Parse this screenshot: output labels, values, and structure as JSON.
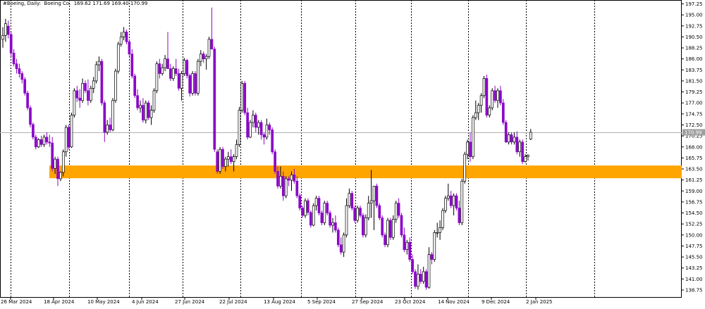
{
  "header": {
    "symbol_period": "#Boeing, Daily:",
    "description": "Boeing Co.",
    "ohlc": "169.62 171.69 169.40 170.99"
  },
  "colors": {
    "bull_candle": "#ffffff",
    "bull_outline": "#000000",
    "bear_candle": "#8b08c8",
    "zone": "#ffa500",
    "current_price_line": "#b0b0b0",
    "price_tag": "#9e9e9e",
    "grid_vertical": "#000000"
  },
  "chart_data": {
    "type": "candlestick",
    "y_axis_ticks": [
      "197.25",
      "195.00",
      "192.75",
      "190.50",
      "188.25",
      "186.00",
      "183.75",
      "181.50",
      "179.25",
      "177.00",
      "174.75",
      "172.50",
      "170.25",
      "168.00",
      "165.75",
      "163.50",
      "161.25",
      "159.00",
      "156.75",
      "154.50",
      "152.25",
      "150.00",
      "147.75",
      "145.50",
      "143.25",
      "141.00",
      "138.75"
    ],
    "x_axis_labels": [
      "26 Mar 2024",
      "18 Apr 2024",
      "10 May 2024",
      "4 Jun 2024",
      "27 Jun 2024",
      "22 Jul 2024",
      "13 Aug 2024",
      "5 Sep 2024",
      "27 Sep 2024",
      "23 Oct 2024",
      "14 Nov 2024",
      "9 Dec 2024",
      "2 Jan 2025"
    ],
    "ylim": [
      137.5,
      198.0
    ],
    "current_price": 170.99,
    "current_price_label": "170.99",
    "zone": {
      "from": 161.6,
      "to": 164.2
    },
    "candles": [
      [
        190,
        192.5,
        188.3,
        190.8
      ],
      [
        190.8,
        194.2,
        189.5,
        193.2
      ],
      [
        192.7,
        193.8,
        190.2,
        191
      ],
      [
        191,
        191.5,
        186.5,
        187.2
      ],
      [
        187.2,
        188,
        184.5,
        185
      ],
      [
        185,
        186,
        183,
        184
      ],
      [
        184,
        185,
        182.2,
        183
      ],
      [
        183,
        183.5,
        181,
        181.8
      ],
      [
        181.8,
        182.3,
        178.5,
        179
      ],
      [
        179,
        179.5,
        175.5,
        176
      ],
      [
        176,
        176.5,
        172,
        172.6
      ],
      [
        172.6,
        173,
        169.5,
        170
      ],
      [
        170,
        170.5,
        167.5,
        168
      ],
      [
        168,
        169.8,
        167.8,
        169.5
      ],
      [
        169.5,
        170.3,
        168,
        168.5
      ],
      [
        168.5,
        170.5,
        168,
        170
      ],
      [
        170,
        171,
        168.5,
        169
      ],
      [
        169,
        170.5,
        168,
        168.8
      ],
      [
        168.8,
        170,
        163,
        163.6
      ],
      [
        163.6,
        166,
        162.5,
        165.5
      ],
      [
        165.5,
        166,
        160,
        161.5
      ],
      [
        161.5,
        163,
        161,
        162.8
      ],
      [
        162.8,
        167.5,
        162,
        167
      ],
      [
        167,
        172.5,
        166,
        172
      ],
      [
        172,
        172.5,
        167.5,
        168
      ],
      [
        168,
        175,
        167.8,
        174.5
      ],
      [
        174.5,
        180,
        174,
        179.5
      ],
      [
        179.5,
        180.5,
        177.2,
        178
      ],
      [
        178,
        179.8,
        176,
        177.5
      ],
      [
        177.5,
        182,
        177,
        181
      ],
      [
        181,
        181.6,
        179,
        179.5
      ],
      [
        179.5,
        181.8,
        176.5,
        177.5
      ],
      [
        177.5,
        180.5,
        177,
        180
      ],
      [
        180,
        182.3,
        179,
        181.5
      ],
      [
        181.5,
        185.5,
        181,
        184.8
      ],
      [
        184.8,
        186.5,
        183.5,
        185.5
      ],
      [
        185.5,
        186,
        176.5,
        177
      ],
      [
        177,
        177.5,
        169,
        171
      ],
      [
        171,
        173.5,
        170.5,
        172.5
      ],
      [
        172.5,
        174,
        171,
        171.5
      ],
      [
        171.5,
        178,
        171.2,
        177.5
      ],
      [
        177.5,
        184,
        177,
        183.5
      ],
      [
        183.5,
        189.5,
        183,
        189
      ],
      [
        189,
        191.5,
        188.5,
        190.5
      ],
      [
        190.5,
        192.5,
        189.8,
        191.5
      ],
      [
        191.5,
        192,
        189,
        189.5
      ],
      [
        189.5,
        190,
        186.5,
        187
      ],
      [
        187,
        188,
        182,
        182.5
      ],
      [
        182.5,
        183,
        178,
        178.5
      ],
      [
        178.5,
        179.8,
        175.5,
        176
      ],
      [
        176,
        177.5,
        175,
        176.5
      ],
      [
        176.5,
        178,
        173,
        173.5
      ],
      [
        173.5,
        177.5,
        172.8,
        177
      ],
      [
        177,
        177.5,
        173.5,
        174
      ],
      [
        174,
        176.5,
        172.5,
        175.5
      ],
      [
        175.5,
        180,
        175,
        179.5
      ],
      [
        179.5,
        185.5,
        179,
        185
      ],
      [
        185,
        186,
        182,
        183
      ],
      [
        183,
        185,
        182.6,
        184.2
      ],
      [
        184.2,
        186.8,
        183.5,
        186
      ],
      [
        186,
        191.5,
        185.2,
        184
      ],
      [
        184,
        185,
        181.5,
        182
      ],
      [
        182,
        184.5,
        181.5,
        184
      ],
      [
        184,
        186,
        182.5,
        183
      ],
      [
        183,
        184,
        179.5,
        180
      ],
      [
        180,
        183.5,
        177.5,
        183
      ],
      [
        183,
        186.2,
        182.5,
        185.7
      ],
      [
        185.7,
        186,
        182,
        182.6
      ],
      [
        182.6,
        183,
        178.3,
        179
      ],
      [
        179,
        183.5,
        178.5,
        183
      ],
      [
        183,
        183.5,
        178.5,
        179
      ],
      [
        179,
        186,
        178.5,
        185.5
      ],
      [
        185.5,
        187.8,
        184.5,
        187
      ],
      [
        187,
        187.5,
        185.2,
        186
      ],
      [
        186,
        187,
        183.8,
        186.5
      ],
      [
        186.5,
        190.5,
        186,
        190
      ],
      [
        190,
        196.5,
        189.5,
        188
      ],
      [
        188,
        188.5,
        167,
        167.5
      ],
      [
        167,
        167.5,
        162.5,
        163
      ],
      [
        163,
        168,
        162.5,
        167.5
      ],
      [
        167.5,
        168,
        163.5,
        164
      ],
      [
        164,
        166,
        163,
        165.5
      ],
      [
        165.5,
        167,
        164,
        166
      ],
      [
        166,
        167.5,
        164.5,
        165
      ],
      [
        165,
        166.5,
        163,
        166
      ],
      [
        166,
        169.5,
        165.5,
        168.5
      ],
      [
        168.5,
        176.2,
        168,
        175.5
      ],
      [
        175.5,
        181.5,
        175,
        181
      ],
      [
        181,
        181.5,
        174.5,
        175
      ],
      [
        175,
        176,
        169.5,
        170
      ],
      [
        170,
        173.5,
        169.8,
        173
      ],
      [
        173,
        175.5,
        172,
        174.5
      ],
      [
        174.5,
        175,
        171,
        172
      ],
      [
        172,
        173.5,
        170.5,
        173
      ],
      [
        173,
        173.5,
        169.5,
        170.5
      ],
      [
        170.5,
        171,
        168.5,
        170
      ],
      [
        170,
        173.8,
        169.5,
        172.5
      ],
      [
        172.5,
        173,
        170.5,
        171.5
      ],
      [
        171.5,
        172,
        166.5,
        167
      ],
      [
        167,
        167.5,
        162.5,
        163
      ],
      [
        163,
        164,
        159.5,
        160
      ],
      [
        160,
        164,
        159.5,
        162
      ],
      [
        162,
        163,
        157,
        158
      ],
      [
        158,
        162,
        157.5,
        161.5
      ],
      [
        161.5,
        162,
        160,
        161.2
      ],
      [
        161.2,
        163,
        159,
        162.3
      ],
      [
        162.3,
        163.5,
        160.5,
        161
      ],
      [
        161,
        162,
        157.5,
        158
      ],
      [
        158,
        158.5,
        155,
        155.5
      ],
      [
        155.5,
        156,
        153.5,
        154
      ],
      [
        154,
        157.5,
        153.5,
        157
      ],
      [
        157,
        157.5,
        154,
        154.6
      ],
      [
        154.6,
        155,
        151.5,
        152
      ],
      [
        152,
        156.5,
        151.8,
        156
      ],
      [
        156,
        158,
        155,
        157.5
      ],
      [
        157.5,
        158,
        154,
        154.5
      ],
      [
        154.5,
        155,
        152,
        152.5
      ],
      [
        152.5,
        157,
        152,
        156.5
      ],
      [
        156.5,
        157,
        154,
        154.5
      ],
      [
        154.5,
        155,
        151.5,
        152
      ],
      [
        152,
        153.5,
        150.5,
        152.5
      ],
      [
        152.5,
        154,
        150.5,
        151
      ],
      [
        151,
        151.5,
        147.5,
        148
      ],
      [
        148,
        149.5,
        146,
        146.5
      ],
      [
        146.5,
        150.5,
        145.5,
        150
      ],
      [
        150,
        157.5,
        149.5,
        156
      ],
      [
        156,
        159.5,
        155.5,
        158.5
      ],
      [
        158.5,
        159,
        155,
        155.5
      ],
      [
        155.5,
        156,
        152.5,
        153
      ],
      [
        153,
        156,
        152.5,
        155.5
      ],
      [
        155.5,
        156,
        153.5,
        154
      ],
      [
        154,
        154.5,
        149.5,
        150
      ],
      [
        150,
        154.2,
        149.5,
        153.5
      ],
      [
        153.5,
        158,
        153,
        156.5
      ],
      [
        156.5,
        163.3,
        153.5,
        157
      ],
      [
        157,
        160,
        151,
        160
      ],
      [
        160,
        160.5,
        155.5,
        156
      ],
      [
        156,
        156.5,
        153,
        153.5
      ],
      [
        153.5,
        154,
        149.5,
        150
      ],
      [
        150,
        150.5,
        147.5,
        148
      ],
      [
        148,
        153.5,
        147.5,
        153
      ],
      [
        153,
        153.5,
        149,
        149.5
      ],
      [
        149.5,
        154,
        149,
        153.2
      ],
      [
        153.2,
        157,
        152.5,
        156.5
      ],
      [
        156.5,
        157.5,
        153.5,
        154
      ],
      [
        154,
        154.5,
        149.5,
        150
      ],
      [
        150,
        151.5,
        146.5,
        147
      ],
      [
        147,
        149,
        146,
        148.5
      ],
      [
        148.5,
        149.5,
        144.5,
        145
      ],
      [
        145,
        146,
        142,
        142.5
      ],
      [
        142.5,
        143,
        139,
        139.5
      ],
      [
        139.5,
        144,
        138.8,
        142
      ],
      [
        142,
        143,
        140,
        140.5
      ],
      [
        140.5,
        143.5,
        140,
        142.5
      ],
      [
        142.5,
        143,
        138.8,
        139.3
      ],
      [
        139.3,
        147.5,
        139,
        146
      ],
      [
        146,
        146.5,
        144,
        145
      ],
      [
        145,
        151,
        144.5,
        150.5
      ],
      [
        150.5,
        152.5,
        149.5,
        150.5
      ],
      [
        150.5,
        153,
        149,
        151.5
      ],
      [
        151.5,
        155.5,
        151,
        155
      ],
      [
        155,
        158,
        154.5,
        157.5
      ],
      [
        157.5,
        160.5,
        157,
        158
      ],
      [
        158,
        159,
        155.5,
        156
      ],
      [
        156,
        158.5,
        154,
        158
      ],
      [
        158,
        158.5,
        155,
        155.5
      ],
      [
        155.5,
        157,
        152,
        152.5
      ],
      [
        152.5,
        161.5,
        152,
        161
      ],
      [
        161,
        167,
        160.5,
        166.5
      ],
      [
        166.5,
        169.5,
        165.5,
        169
      ],
      [
        169,
        171,
        165,
        166
      ],
      [
        166,
        174.5,
        165.5,
        174
      ],
      [
        174,
        177.5,
        173.5,
        175
      ],
      [
        175,
        177,
        173.5,
        176.5
      ],
      [
        176.5,
        179,
        175,
        178.5
      ],
      [
        178.5,
        182.5,
        178,
        182
      ],
      [
        182,
        182.8,
        174,
        174.5
      ],
      [
        174.5,
        176.5,
        174,
        176
      ],
      [
        176,
        180,
        175.5,
        179.5
      ],
      [
        179.5,
        180.5,
        177,
        177.5
      ],
      [
        177.5,
        180,
        176,
        179.5
      ],
      [
        179.5,
        180.5,
        176.5,
        177
      ],
      [
        177,
        177.8,
        172.5,
        173
      ],
      [
        173,
        173.5,
        168.8,
        169
      ],
      [
        169,
        171,
        168.5,
        170.5
      ],
      [
        170.5,
        171,
        168.5,
        169
      ],
      [
        169,
        171,
        168.5,
        170
      ],
      [
        170,
        171.2,
        166.5,
        167
      ],
      [
        167,
        169.5,
        166,
        169
      ],
      [
        169,
        169.5,
        164.5,
        165
      ],
      [
        165,
        166.5,
        164.8,
        166
      ],
      [
        166,
        166.5,
        165.2,
        166.3
      ],
      [
        169.62,
        171.69,
        169.4,
        170.99
      ]
    ]
  }
}
